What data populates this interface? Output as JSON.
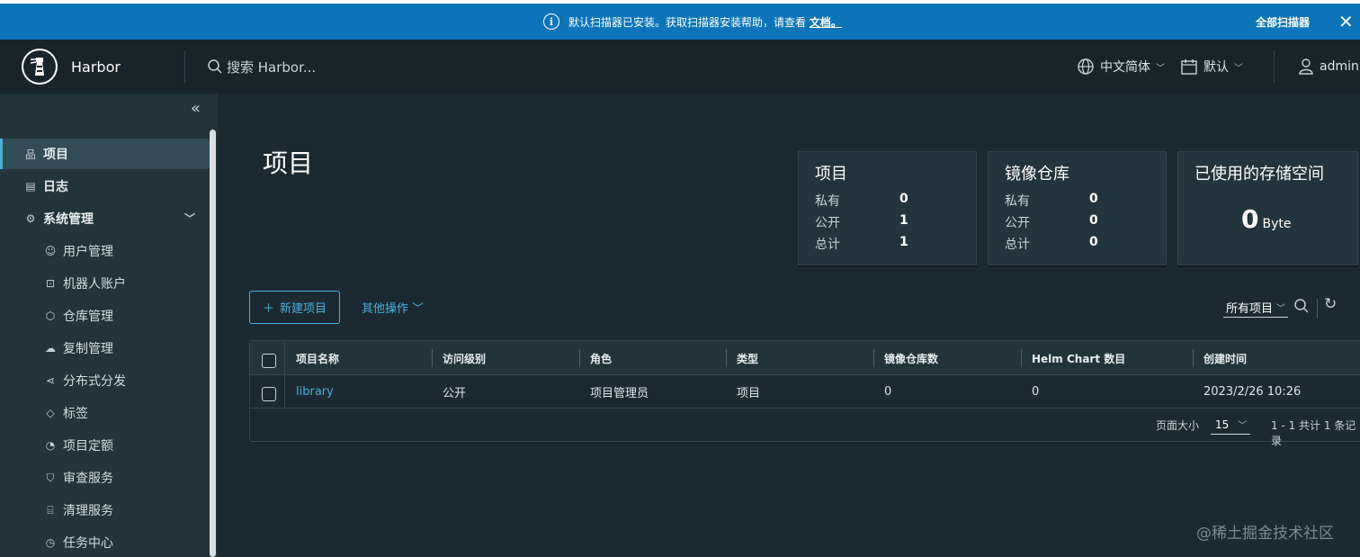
{
  "banner": {
    "message": "默认扫描器已安装。获取扫描器安装帮助，请查看",
    "doc_link": "文档。",
    "all_scanners": "全部扫描器",
    "close": "✕"
  },
  "header": {
    "brand": "Harbor",
    "search_placeholder": "搜索 Harbor...",
    "language": "中文简体",
    "datetime": "默认",
    "user": "admin"
  },
  "sidebar": {
    "items": [
      {
        "label": "项目",
        "icon": "project-icon"
      },
      {
        "label": "日志",
        "icon": "log-icon"
      },
      {
        "label": "系统管理",
        "icon": "admin-icon"
      }
    ],
    "sub_items": [
      {
        "label": "用户管理",
        "icon": "users-icon"
      },
      {
        "label": "机器人账户",
        "icon": "robot-icon"
      },
      {
        "label": "仓库管理",
        "icon": "registry-icon"
      },
      {
        "label": "复制管理",
        "icon": "replication-icon"
      },
      {
        "label": "分布式分发",
        "icon": "distribution-icon"
      },
      {
        "label": "标签",
        "icon": "tag-icon"
      },
      {
        "label": "项目定额",
        "icon": "quota-icon"
      },
      {
        "label": "审查服务",
        "icon": "shield-icon"
      },
      {
        "label": "清理服务",
        "icon": "trash-icon"
      },
      {
        "label": "任务中心",
        "icon": "job-icon"
      }
    ]
  },
  "main": {
    "title": "项目",
    "cards": {
      "projects": {
        "title": "项目",
        "rows": [
          {
            "label": "私有",
            "value": "0"
          },
          {
            "label": "公开",
            "value": "1"
          },
          {
            "label": "总计",
            "value": "1"
          }
        ]
      },
      "repos": {
        "title": "镜像仓库",
        "rows": [
          {
            "label": "私有",
            "value": "0"
          },
          {
            "label": "公开",
            "value": "0"
          },
          {
            "label": "总计",
            "value": "0"
          }
        ]
      },
      "storage": {
        "title": "已使用的存储空间",
        "value": "0",
        "unit": "Byte"
      }
    },
    "new_project": "新建项目",
    "other_actions": "其他操作",
    "filter": "所有项目",
    "table": {
      "headers": [
        "项目名称",
        "访问级别",
        "角色",
        "类型",
        "镜像仓库数",
        "Helm Chart 数目",
        "创建时间"
      ],
      "rows": [
        [
          "library",
          "公开",
          "项目管理员",
          "项目",
          "0",
          "0",
          "2023/2/26 10:26"
        ]
      ]
    },
    "pagination": {
      "page_size_label": "页面大小",
      "page_size": "15",
      "summary": "1 - 1 共计 1 条记录"
    }
  },
  "watermark": "@稀土掘金技术社区",
  "colors": {
    "accent": "#49afd9",
    "banner": "#0c75b9",
    "background": "#1b2a32"
  }
}
